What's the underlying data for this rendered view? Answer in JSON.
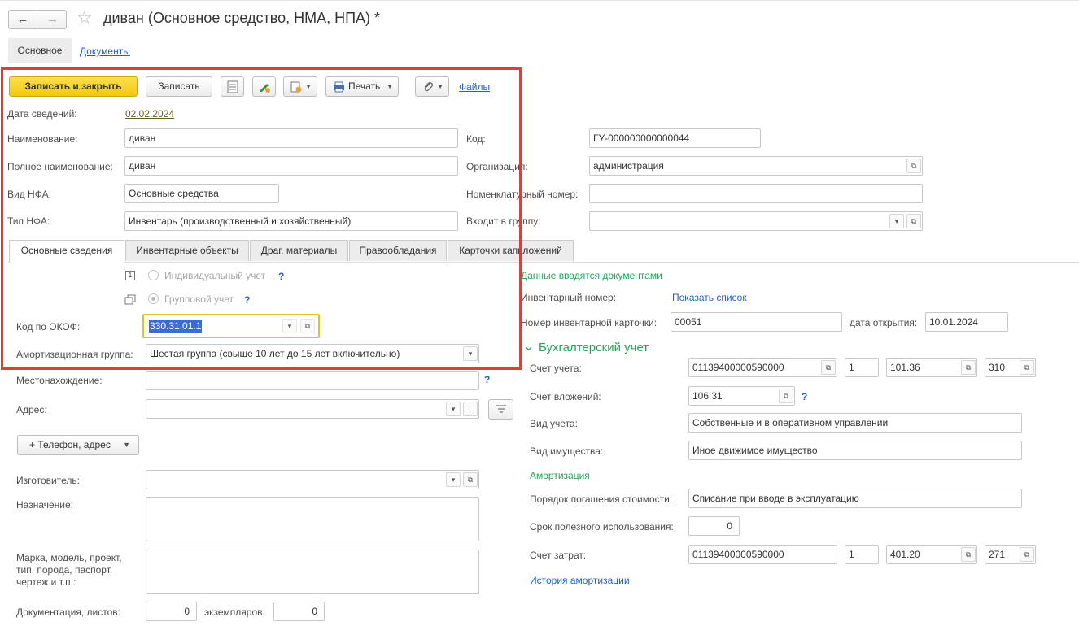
{
  "window": {
    "title": "диван (Основное средство, НМА, НПА) *",
    "back_glyph": "←",
    "forward_glyph": "→",
    "star_glyph": "☆"
  },
  "form_tabs": [
    "Основное",
    "Документы"
  ],
  "toolbar": {
    "save_close": "Записать и закрыть",
    "save": "Записать",
    "print": "Печать",
    "files": "Файлы"
  },
  "header": {
    "date_label": "Дата сведений:",
    "date_value": "02.02.2024",
    "name_label": "Наименование:",
    "name_value": "диван",
    "fullname_label": "Полное наименование:",
    "fullname_value": "диван",
    "type_label": "Вид НФА:",
    "type_value": "Основные средства",
    "kind_label": "Тип НФА:",
    "kind_value": "Инвентарь (производственный и хозяйственный)",
    "code_label": "Код:",
    "code_value": "ГУ-000000000000044",
    "org_label": "Организация:",
    "org_value": "администрация",
    "nomnum_label": "Номенклатурный номер:",
    "nomnum_value": "",
    "group_label": "Входит в группу:",
    "group_value": ""
  },
  "section_tabs": [
    "Основные сведения",
    "Инвентарные объекты",
    "Драг. материалы",
    "Правообладания",
    "Карточки капвложений"
  ],
  "left": {
    "individual": "Индивидуальный учет",
    "group": "Групповой учет",
    "help_mark": "?",
    "okof_label": "Код по ОКОФ:",
    "okof_value": "330.31.01.1",
    "amort_group_label": "Амортизационная группа:",
    "amort_group_value": "Шестая группа (свыше 10 лет до 15 лет включительно)",
    "location_label": "Местонахождение:",
    "location_value": "",
    "address_label": "Адрес:",
    "address_value": "",
    "phone_button": "+ Телефон, адрес",
    "maker_label": "Изготовитель:",
    "maker_value": "",
    "purpose_label": "Назначение:",
    "brand_label": "Марка, модель, проект, тип, порода, паспорт, чертеж и т.п.:",
    "docs_label": "Документация, листов:",
    "docs_value": "0",
    "copies_label": "экземпляров:",
    "copies_value": "0"
  },
  "right": {
    "notice": "Данные вводятся документами",
    "inv_num_label": "Инвентарный номер:",
    "inv_num_link": "Показать список",
    "card_num_label": "Номер инвентарной карточки:",
    "card_num_value": "00051",
    "open_date_label": "дата открытия:",
    "open_date_value": "10.01.2024",
    "accounting_title": "Бухгалтерский учет",
    "account_label": "Счет учета:",
    "account_value": "01139400000590000",
    "account_kfo": "1",
    "account_num": "101.36",
    "account_kosgu": "310",
    "invest_label": "Счет вложений:",
    "invest_value": "106.31",
    "acc_type_label": "Вид учета:",
    "acc_type_value": "Собственные и в оперативном управлении",
    "property_label": "Вид имущества:",
    "property_value": "Иное движимое имущество",
    "amort_title": "Амортизация",
    "repay_label": "Порядок погашения стоимости:",
    "repay_value": "Списание при вводе в эксплуатацию",
    "life_label": "Срок полезного использования:",
    "life_value": "0",
    "cost_label": "Счет затрат:",
    "cost_value": "01139400000590000",
    "cost_kfo": "1",
    "cost_num": "401.20",
    "cost_kosgu": "271",
    "history_link": "История амортизации"
  },
  "colors": {
    "primary_button": "#f2c70f",
    "highlight_frame": "#d9403a",
    "okof_focus": "#e2c12a",
    "selection": "#3d6bd4",
    "green_text": "#26a35a",
    "link": "#2a5fbf"
  }
}
